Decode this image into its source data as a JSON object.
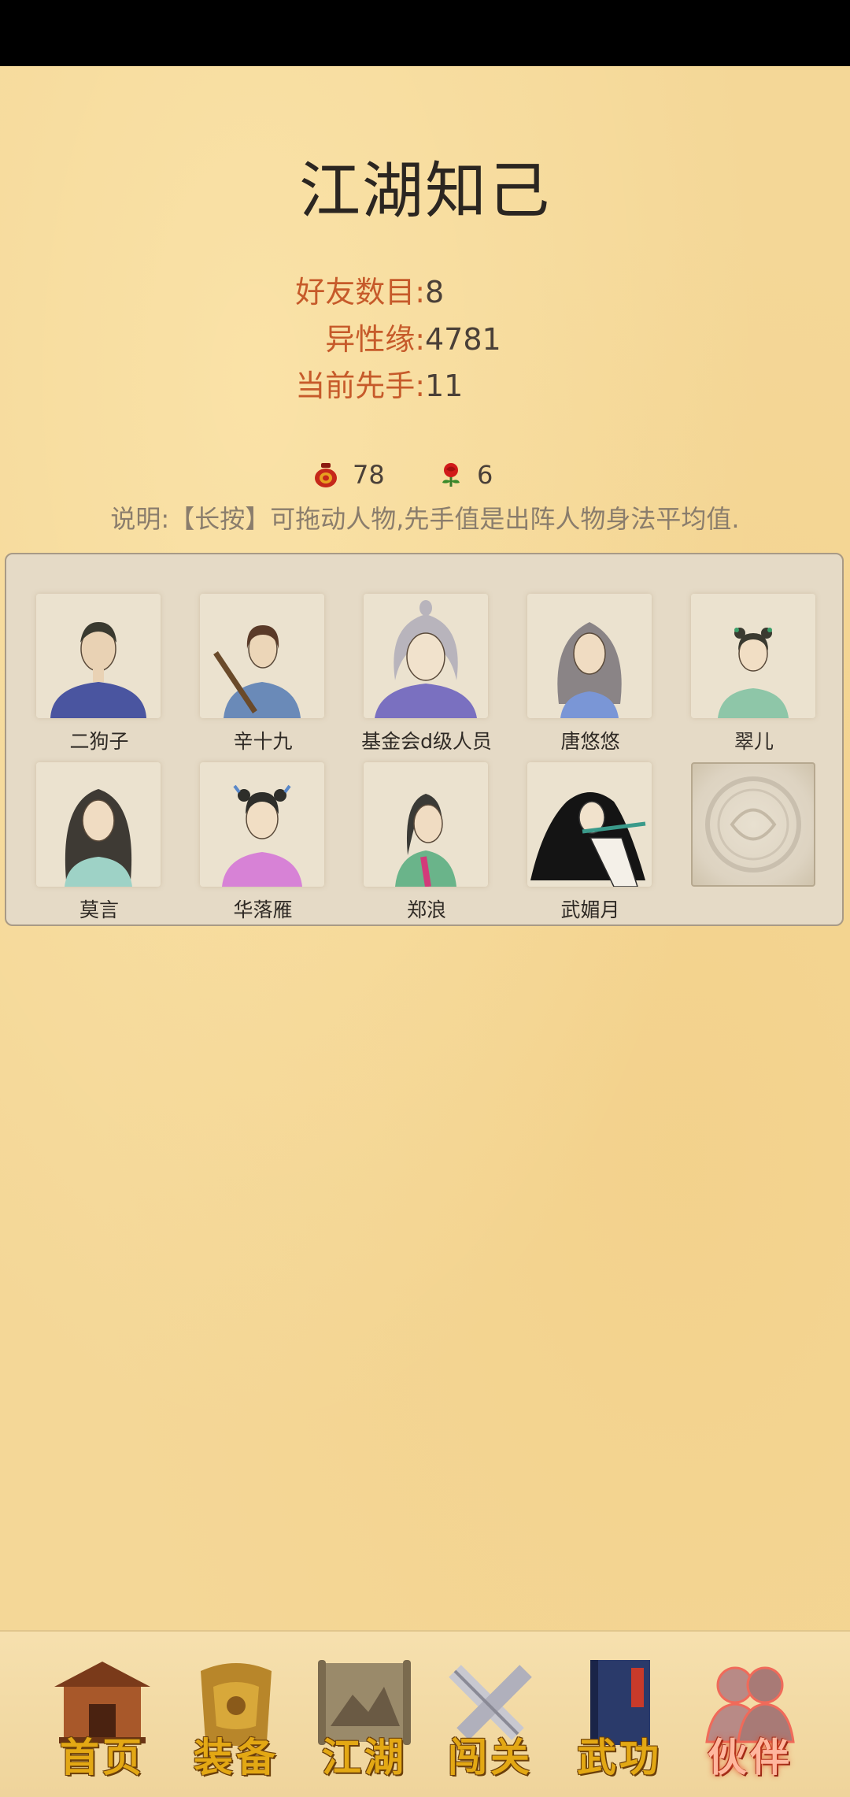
{
  "page": {
    "title": "江湖知己"
  },
  "stats": [
    {
      "label": "好友数目:",
      "value": "8"
    },
    {
      "label": "异性缘:",
      "value": "4781"
    },
    {
      "label": "当前先手:",
      "value": "11"
    }
  ],
  "resources": {
    "wine": {
      "icon": "wine-jar-icon",
      "value": "78"
    },
    "rose": {
      "icon": "rose-icon",
      "value": "6"
    }
  },
  "note": "说明:【长按】可拖动人物,先手值是出阵人物身法平均值.",
  "companions": [
    {
      "name": "二狗子",
      "icon": "portrait-man-icon"
    },
    {
      "name": "辛十九",
      "icon": "portrait-swordsman-icon"
    },
    {
      "name": "基金会d级人员",
      "icon": "portrait-white-hair-icon"
    },
    {
      "name": "唐悠悠",
      "icon": "portrait-lady-icon"
    },
    {
      "name": "翠儿",
      "icon": "portrait-maid-icon"
    },
    {
      "name": "莫言",
      "icon": "portrait-lady-icon"
    },
    {
      "name": "华落雁",
      "icon": "portrait-maid-icon"
    },
    {
      "name": "郑浪",
      "icon": "portrait-man-icon"
    },
    {
      "name": "武媚月",
      "icon": "portrait-flute-icon"
    }
  ],
  "empty_slot_icon": "empty-slot-emblem-icon",
  "nav": [
    {
      "label": "首页",
      "icon": "house-icon",
      "active": false
    },
    {
      "label": "装备",
      "icon": "armor-icon",
      "active": false
    },
    {
      "label": "江湖",
      "icon": "scroll-map-icon",
      "active": false
    },
    {
      "label": "闯关",
      "icon": "crossed-swords-icon",
      "active": false
    },
    {
      "label": "武功",
      "icon": "martial-book-icon",
      "active": false
    },
    {
      "label": "伙伴",
      "icon": "partners-icon",
      "active": true
    }
  ],
  "colors": {
    "accent_label": "#c65a2a",
    "background": "#f4d797",
    "nav_text": "#e3a814"
  }
}
